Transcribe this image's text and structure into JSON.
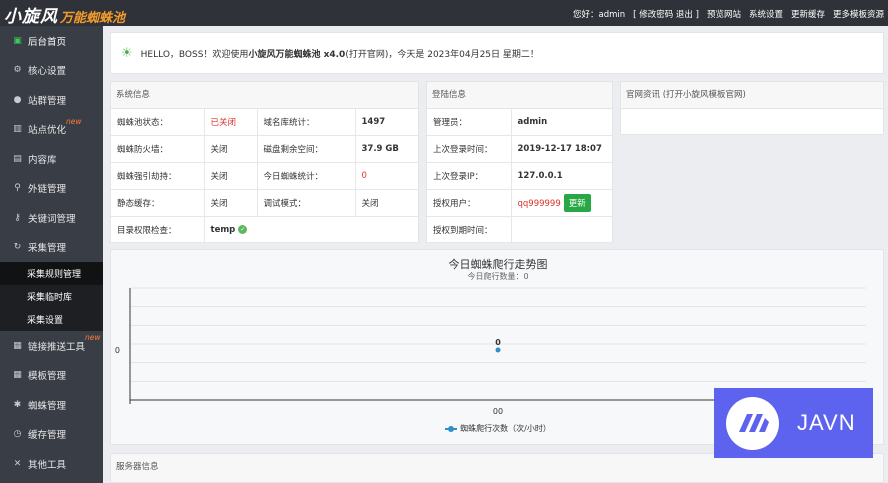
{
  "header": {
    "logo_main": "小旋风",
    "logo_sub": "万能蜘蛛池",
    "greeting": "您好：admin",
    "change_password": "[ 修改密码",
    "logout": "退出 ]",
    "preview_site": "预览网站",
    "system_settings": "系统设置",
    "update_cache": "更新缓存",
    "more_templates": "更多模板资源"
  },
  "sidebar": {
    "items": [
      {
        "label": "后台首页",
        "icon": "monitor-icon"
      },
      {
        "label": "核心设置",
        "icon": "gear-icon"
      },
      {
        "label": "站群管理",
        "icon": "user-icon"
      },
      {
        "label": "站点优化",
        "icon": "chart-icon",
        "badge": "new"
      },
      {
        "label": "内容库",
        "icon": "document-icon"
      },
      {
        "label": "外链管理",
        "icon": "link-icon"
      },
      {
        "label": "关键词管理",
        "icon": "key-icon"
      },
      {
        "label": "采集管理",
        "icon": "refresh-icon"
      }
    ],
    "sub_items": [
      "采集规则管理",
      "采集临时库",
      "采集设置"
    ],
    "items_after": [
      {
        "label": "链接推送工具",
        "icon": "grid-icon",
        "badge": "new"
      },
      {
        "label": "模板管理",
        "icon": "windows-icon"
      },
      {
        "label": "蜘蛛管理",
        "icon": "spider-icon"
      },
      {
        "label": "缓存管理",
        "icon": "clock-icon"
      },
      {
        "label": "其他工具",
        "icon": "tools-icon"
      }
    ]
  },
  "notice": {
    "prefix": "HELLO，BOSS！欢迎使用 ",
    "product": "小旋风万能蜘蛛池 x4.0",
    "suffix": " (打开官网)，今天是 2023年04月25日 星期二！"
  },
  "system_info": {
    "title": "系统信息",
    "rows": [
      [
        "蜘蛛池状态：",
        "已关闭",
        "域名库统计：",
        "1497"
      ],
      [
        "蜘蛛防火墙：",
        "关闭",
        "磁盘剩余空间：",
        "37.9 GB"
      ],
      [
        "蜘蛛强引劫持：",
        "关闭",
        "今日蜘蛛统计：",
        "0"
      ],
      [
        "静态缓存：",
        "关闭",
        "调试模式：",
        "关闭"
      ]
    ],
    "perm_label": "目录权限检查：",
    "perm_value": "temp"
  },
  "login_info": {
    "title": "登陆信息",
    "admin_label": "管理员：",
    "admin_value": "admin",
    "last_time_label": "上次登录时间：",
    "last_time_value": "2019-12-17 18:07",
    "last_ip_label": "上次登录IP：",
    "last_ip_value": "127.0.0.1",
    "auth_user_label": "授权用户：",
    "auth_user_value": "qq999999",
    "update_button": "更新",
    "expire_label": "授权到期时间：",
    "expire_value": ""
  },
  "news": {
    "title": "官网资讯 (打开小旋风模板官网)"
  },
  "chart_data": {
    "type": "line",
    "title": "今日蜘蛛爬行走势图",
    "subtitle": "今日爬行数量：0",
    "categories": [
      "00"
    ],
    "series": [
      {
        "name": "蜘蛛爬行次数（次/小时）",
        "values": [
          0
        ],
        "color": "#2f8fc9"
      }
    ],
    "y_tick_labels": [
      "0"
    ],
    "data_labels": [
      "0"
    ],
    "grid": true
  },
  "server_info": {
    "title": "服务器信息"
  },
  "watermark": {
    "text": "JAVN"
  }
}
